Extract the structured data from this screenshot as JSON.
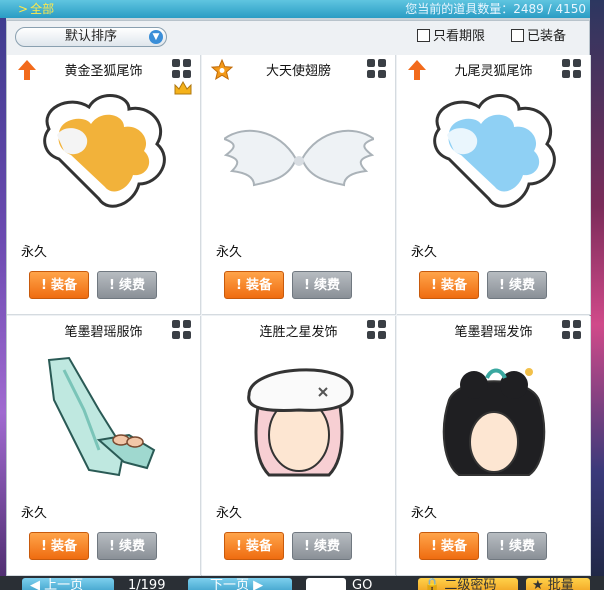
{
  "topbar": {
    "tab_label": "全部",
    "item_count_label": "您当前的道具数量：2489 / 4150"
  },
  "controls": {
    "sort_label": "默认排序",
    "filter_limited_label": "只看期限",
    "filter_equipped_label": "已装备"
  },
  "items": [
    {
      "name": "黄金圣狐尾饰",
      "duration": "永久",
      "equip_label": "装备",
      "renew_label": "续费",
      "badge": "up-arrow",
      "crown": true
    },
    {
      "name": "大天使翅膀",
      "duration": "永久",
      "equip_label": "装备",
      "renew_label": "续费",
      "badge": "star"
    },
    {
      "name": "九尾灵狐尾饰",
      "duration": "永久",
      "equip_label": "装备",
      "renew_label": "续费",
      "badge": "up-arrow"
    },
    {
      "name": "笔墨碧瑶服饰",
      "duration": "永久",
      "equip_label": "装备",
      "renew_label": "续费"
    },
    {
      "name": "连胜之星发饰",
      "duration": "永久",
      "equip_label": "装备",
      "renew_label": "续费"
    },
    {
      "name": "笔墨碧瑶发饰",
      "duration": "永久",
      "equip_label": "装备",
      "renew_label": "续费"
    }
  ],
  "pagination": {
    "prev_label": "上一页",
    "page_label": "1/199",
    "next_label": "下一页",
    "go_label": "GO",
    "password_label": "二级密码",
    "bulk_label": "批量"
  },
  "colors": {
    "accent_orange": "#ef6c10",
    "renew_gray": "#8a9097",
    "topbar_blue": "#2a9cc4",
    "tab_yellow": "#ffe94a"
  }
}
